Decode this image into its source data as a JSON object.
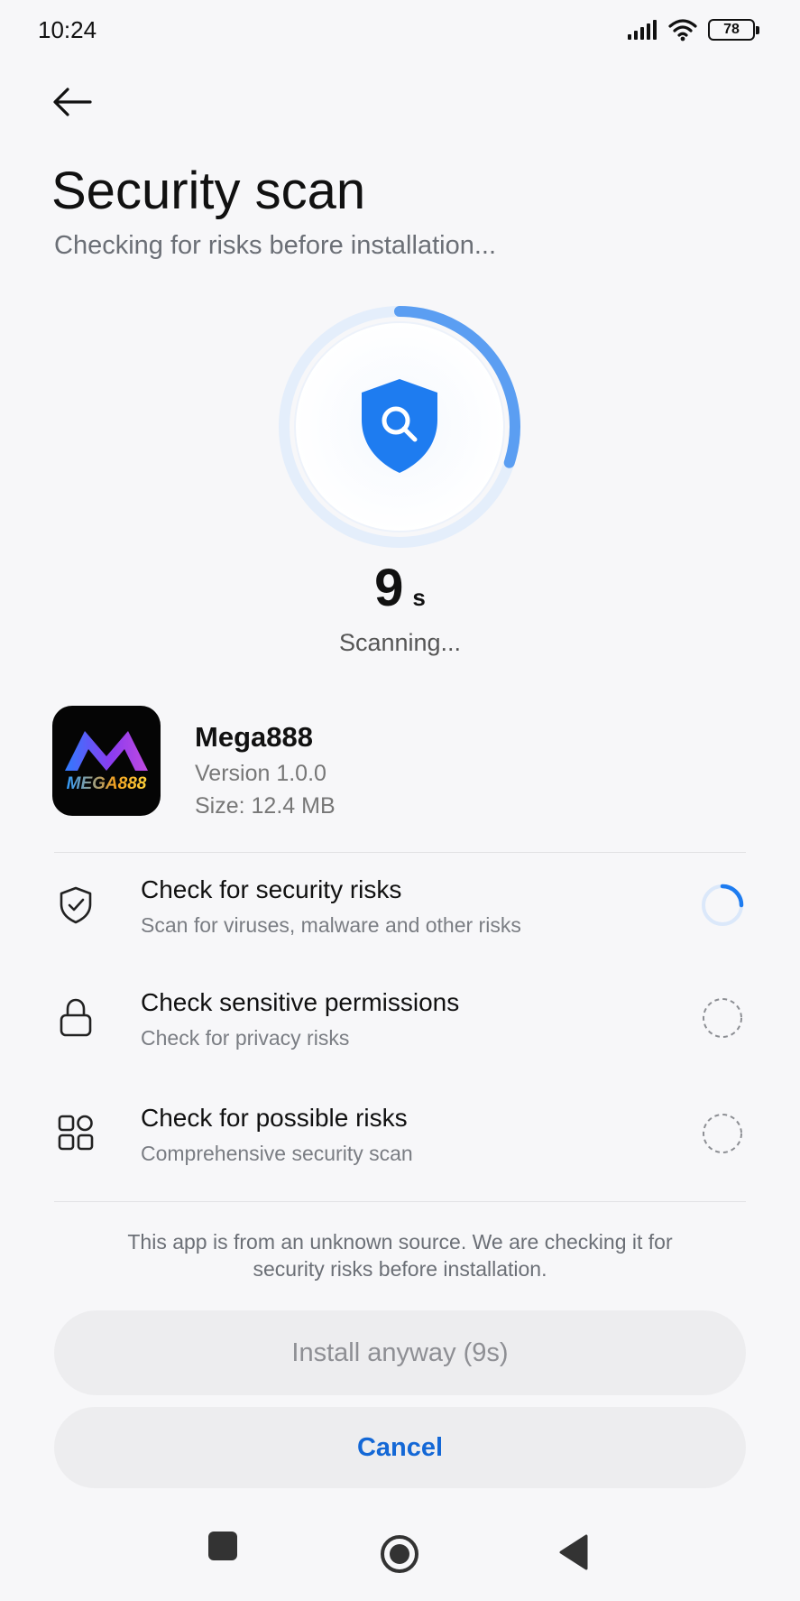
{
  "status_bar": {
    "time": "10:24",
    "battery": "78"
  },
  "header": {
    "title": "Security scan",
    "subtitle": "Checking for risks before installation..."
  },
  "scan": {
    "seconds": "9",
    "unit": "s",
    "status": "Scanning...",
    "progress": 0.3
  },
  "app": {
    "name": "Mega888",
    "version": "Version 1.0.0",
    "size": "Size: 12.4 MB",
    "logo_text": "MEGA888"
  },
  "checks": [
    {
      "title": "Check for security risks",
      "desc": "Scan for viruses, malware and other risks",
      "icon": "shield-check-icon",
      "state": "in-progress"
    },
    {
      "title": "Check sensitive permissions",
      "desc": "Check for privacy risks",
      "icon": "lock-icon",
      "state": "pending"
    },
    {
      "title": "Check for possible risks",
      "desc": "Comprehensive security scan",
      "icon": "apps-grid-icon",
      "state": "pending"
    }
  ],
  "notice": "This app is from an unknown source. We are checking it for security risks before installation.",
  "buttons": {
    "install": "Install anyway (9s)",
    "cancel": "Cancel"
  },
  "colors": {
    "accent": "#1468d6",
    "shield": "#1e7cf0",
    "ring_track": "#e4eefb",
    "ring_progress": "#4d97f3"
  }
}
